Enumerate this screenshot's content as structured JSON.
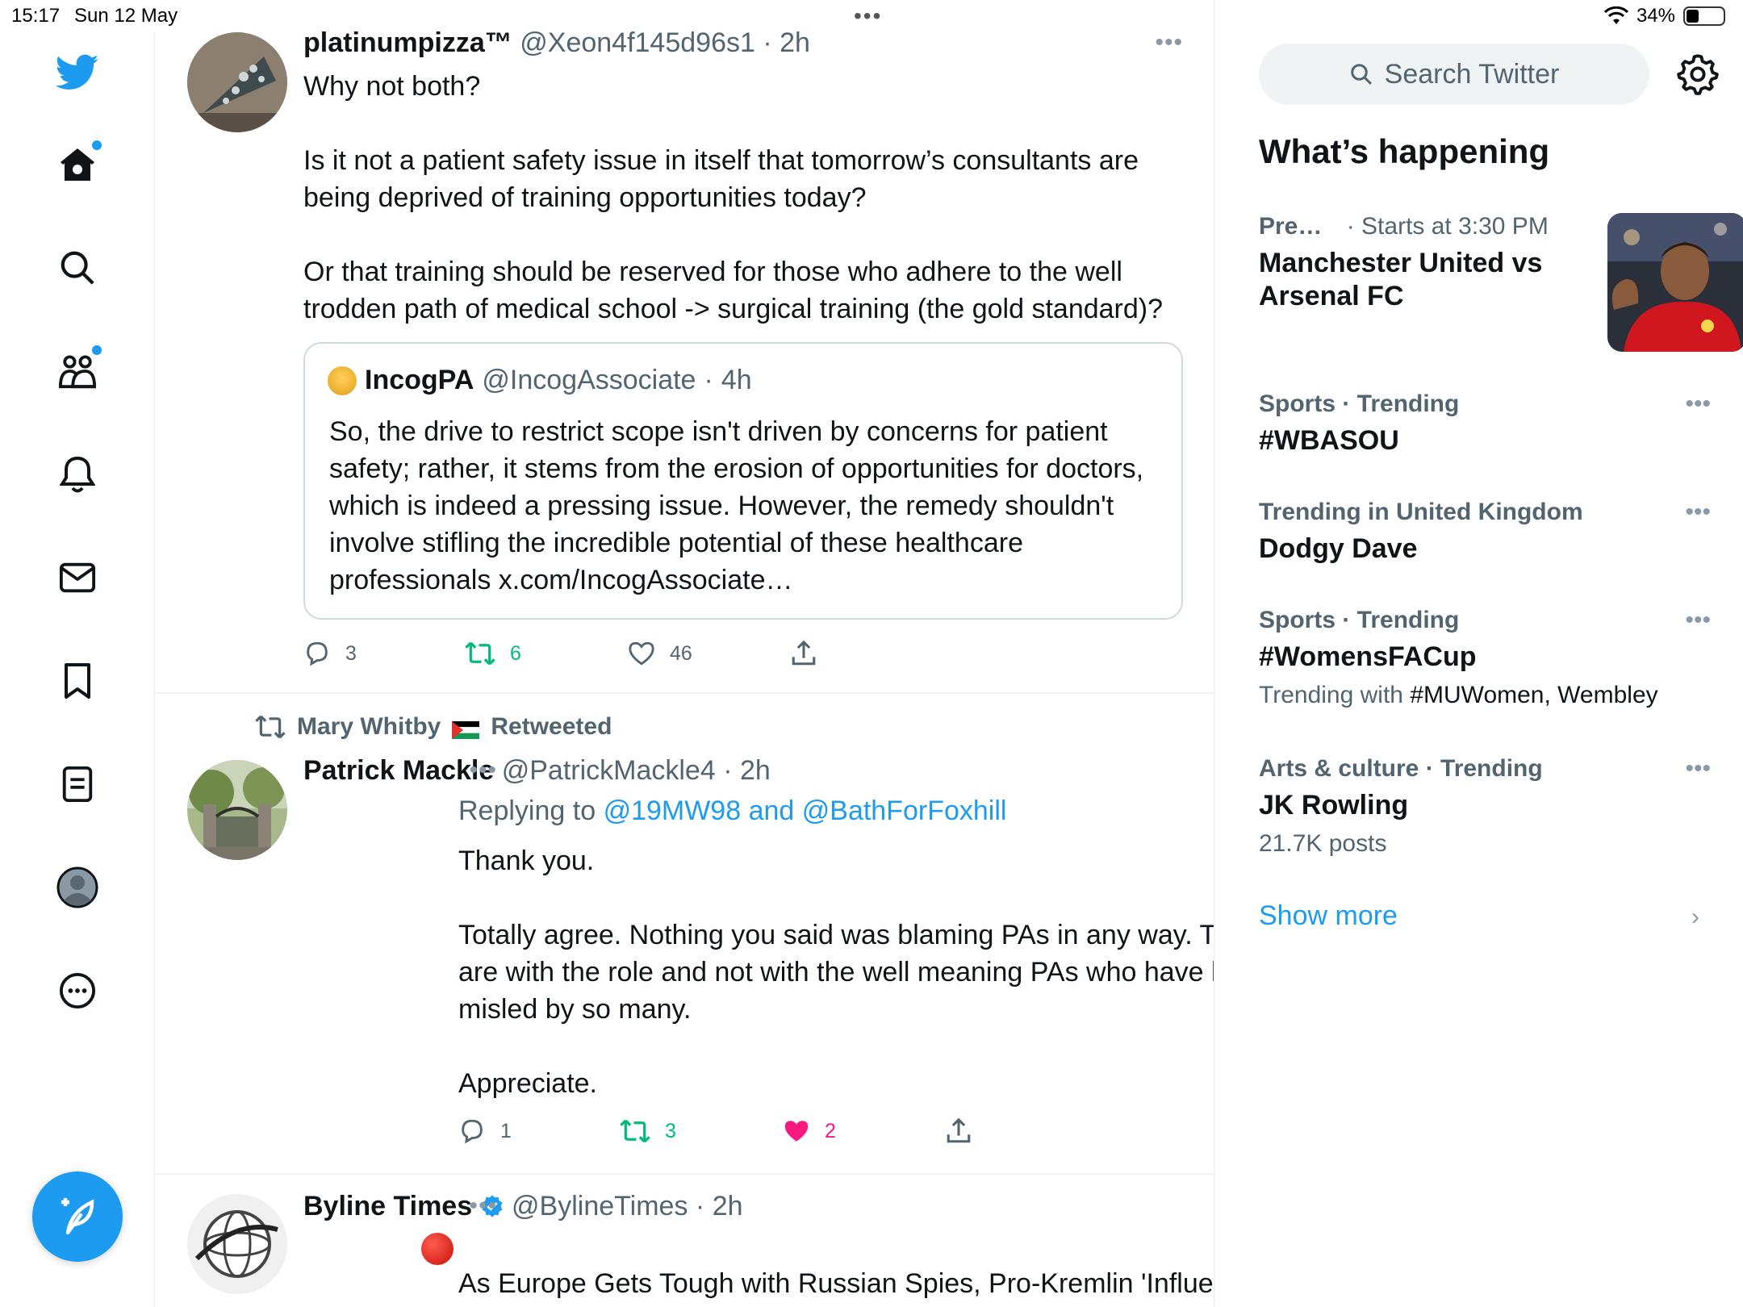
{
  "status_bar": {
    "time": "15:17",
    "date": "Sun 12 May",
    "battery": "34%",
    "battery_level": 0.34
  },
  "nav": {
    "items": [
      "twitter-logo",
      "home",
      "search",
      "communities",
      "notifications",
      "messages",
      "bookmarks",
      "lists",
      "profile",
      "more"
    ],
    "compose_label": "Tweet"
  },
  "tweets": [
    {
      "name": "platinumpizza™",
      "handle": "@Xeon4f145d96s1",
      "time": "2h",
      "text": "Why not both?\n\nIs it not a patient safety issue in itself that tomorrow’s consultants are being deprived of training opportunities today?\n\nOr that training should be reserved for those who adhere to the well trodden path of medical school -> surgical training (the gold standard)?",
      "quote": {
        "name": "IncogPA",
        "handle": "@IncogAssociate",
        "time": "4h",
        "text": "So, the drive to restrict scope isn't driven by concerns for patient safety; rather, it stems from the erosion of opportunities for doctors, which is indeed a pressing issue. However, the remedy shouldn't involve stifling the incredible potential of these healthcare professionals x.com/IncogAssociate…"
      },
      "replies": "3",
      "retweets": "6",
      "likes": "46"
    },
    {
      "retweeted_by": "Mary Whitby",
      "retweeted_label": "Retweeted",
      "name": "Patrick Mackle",
      "handle": "@PatrickMackle4",
      "time": "2h",
      "replying_label": "Replying to",
      "replying_to": "@19MW98 and @BathForFoxhill",
      "text": "Thank you.\n\nTotally agree.  Nothing you said was blaming PAs in any way.  The issues are with the role and not with the well meaning PAs who have been misled by so many.\n\nAppreciate.",
      "replies": "1",
      "retweets": "3",
      "likes": "2"
    },
    {
      "name": "Byline Times",
      "handle": "@BylineTimes",
      "time": "2h",
      "text": "As Europe Gets Tough with Russian Spies, Pro-Kremlin 'Influencers' Are Operating in Plain Sight in the US"
    }
  ],
  "right": {
    "search_placeholder": "Search Twitter",
    "section_title": "What’s happening",
    "trends": [
      {
        "category": "Pre…",
        "extra": "· Starts at 3:30 PM",
        "title": "Manchester United vs Arsenal FC"
      },
      {
        "category": "Sports · Trending",
        "title": "#WBASOU"
      },
      {
        "category": "Trending in United Kingdom",
        "title": "Dodgy Dave"
      },
      {
        "category": "Sports · Trending",
        "title": "#WomensFACup",
        "sub_prefix": "Trending with",
        "sub_value": "#MUWomen, Wembley"
      },
      {
        "category": "Arts & culture · Trending",
        "title": "JK Rowling",
        "sub": "21.7K posts"
      }
    ],
    "show_more": "Show more"
  },
  "colors": {
    "accent": "#1d9bf0",
    "retweet": "#00ba7c",
    "like": "#f91880",
    "muted": "#536471"
  }
}
